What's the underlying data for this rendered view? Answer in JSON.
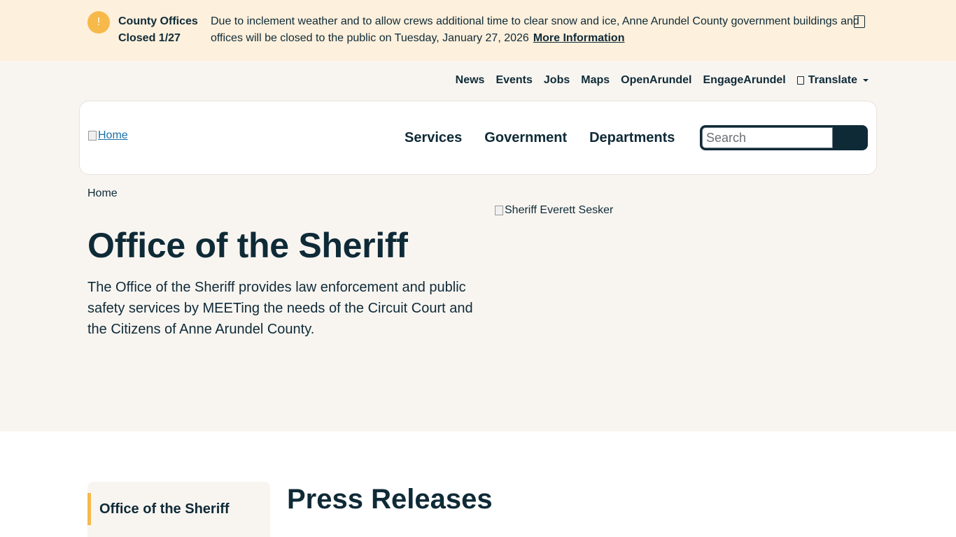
{
  "alert": {
    "icon": "exclamation-icon",
    "icon_glyph": "!",
    "title": "County Offices Closed 1/27",
    "message": "Due to inclement weather and to allow crews additional time to clear snow and ice, Anne Arundel County government buildings and offices will be closed to the public on Tuesday, January 27, 2026",
    "link_text": "More Information"
  },
  "utility_nav": {
    "items": [
      "News",
      "Events",
      "Jobs",
      "Maps",
      "OpenArundel",
      "EngageArundel"
    ],
    "translate_label": "Translate"
  },
  "header": {
    "logo_alt": "Home",
    "nav": [
      "Services",
      "Government",
      "Departments"
    ],
    "search_placeholder": "Search"
  },
  "hero": {
    "breadcrumb": "Home",
    "title": "Office of the Sheriff",
    "description": "The Office of the Sheriff provides law enforcement and public safety services by MEETing the needs of the Circuit Court and the Citizens of Anne Arundel County.",
    "image_alt": "Sheriff Everett Sesker"
  },
  "content": {
    "sidenav_item": "Office of the Sheriff",
    "section_title": "Press Releases"
  },
  "colors": {
    "alert_bg": "#fdf0dc",
    "accent": "#f6b94a",
    "header_bg": "#f8f5f1",
    "text_dark": "#0f2a37"
  }
}
